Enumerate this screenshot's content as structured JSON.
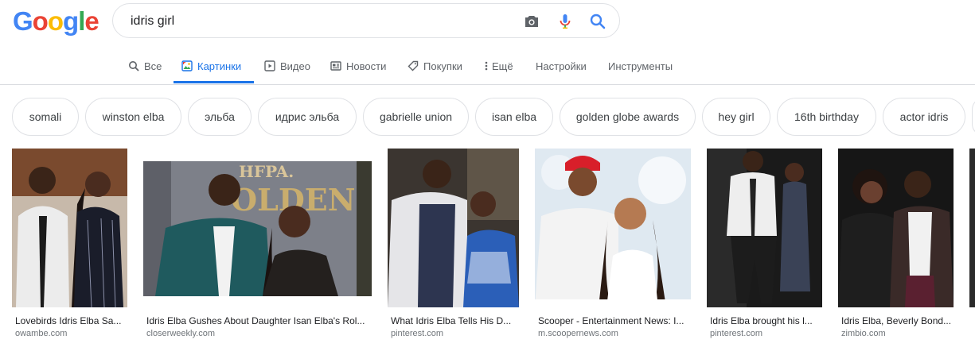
{
  "logo": {
    "letters": [
      "G",
      "o",
      "o",
      "g",
      "l",
      "e"
    ],
    "colors": [
      "#4285f4",
      "#ea4335",
      "#fbbc05",
      "#4285f4",
      "#34a853",
      "#ea4335"
    ]
  },
  "search": {
    "query": "idris girl"
  },
  "tabs": [
    {
      "label": "Все",
      "icon": "search-icon"
    },
    {
      "label": "Картинки",
      "icon": "image-icon",
      "active": true
    },
    {
      "label": "Видео",
      "icon": "video-icon"
    },
    {
      "label": "Новости",
      "icon": "news-icon"
    },
    {
      "label": "Покупки",
      "icon": "tag-icon"
    },
    {
      "label": "Ещё",
      "icon": "more-vert-icon"
    },
    {
      "label": "Настройки"
    },
    {
      "label": "Инструменты"
    }
  ],
  "chips": [
    "somali",
    "winston elba",
    "эльба",
    "идрис эльба",
    "gabrielle union",
    "isan elba",
    "golden globe awards",
    "hey girl",
    "16th birthday",
    "actor idris"
  ],
  "results": [
    {
      "caption": "Lovebirds Idris Elba Sa...",
      "site": "owambe.com"
    },
    {
      "caption": "Idris Elba Gushes About Daughter Isan Elba's Rol...",
      "site": "closerweekly.com"
    },
    {
      "caption": "What Idris Elba Tells His D...",
      "site": "pinterest.com"
    },
    {
      "caption": "Scooper - Entertainment News: I...",
      "site": "m.scoopernews.com"
    },
    {
      "caption": "Idris Elba brought his l...",
      "site": "pinterest.com"
    },
    {
      "caption": "Idris Elba, Beverly Bond...",
      "site": "zimbio.com"
    }
  ],
  "colors": {
    "accent": "#1a73e8",
    "border": "#dfe1e5",
    "muted": "#5f6368"
  }
}
